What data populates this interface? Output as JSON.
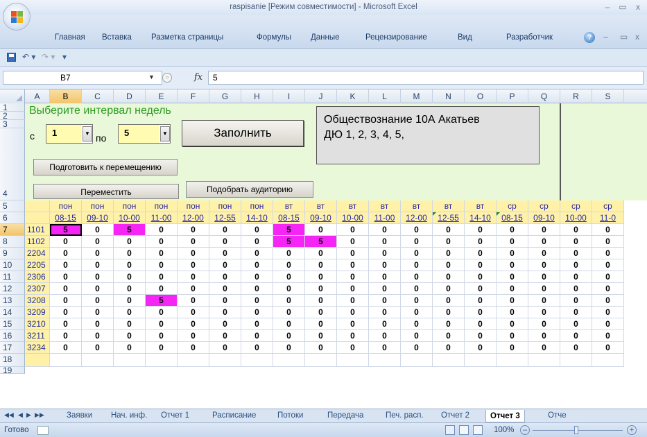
{
  "window": {
    "title": "raspisanie  [Режим совместимости]  -  Microsoft Excel",
    "minimize": "–",
    "restore": "▭",
    "close": "x"
  },
  "ribbon": {
    "tabs": [
      "Главная",
      "Вставка",
      "Разметка страницы",
      "Формулы",
      "Данные",
      "Рецензирование",
      "Вид",
      "Разработчик"
    ],
    "help": "?"
  },
  "formula_bar": {
    "name_box": "B7",
    "fx": "fx",
    "value": "5"
  },
  "columns": [
    "A",
    "B",
    "C",
    "D",
    "E",
    "F",
    "G",
    "H",
    "I",
    "J",
    "K",
    "L",
    "M",
    "N",
    "O",
    "P",
    "Q",
    "R",
    "S"
  ],
  "row_numbers": [
    "1",
    "2",
    "3",
    "4",
    "5",
    "6",
    "7",
    "8",
    "9",
    "10",
    "11",
    "12",
    "13",
    "14",
    "15",
    "16",
    "17",
    "18",
    "19"
  ],
  "controls": {
    "interval_label": "Выберите интервал недель",
    "from_label": "с",
    "from_value": "1",
    "to_label": "по",
    "to_value": "5",
    "fill_button": "Заполнить",
    "info_line1": "Обществознание 10А Акатьев",
    "info_line2": "ДЮ  1, 2, 3, 4, 5,",
    "prepare_button": "Подготовить к перемещению",
    "move_button": "Переместить",
    "pick_room_button": "Подобрать аудиторию"
  },
  "grid": {
    "days": [
      "пон",
      "пон",
      "пон",
      "пон",
      "пон",
      "пон",
      "пон",
      "вт",
      "вт",
      "вт",
      "вт",
      "вт",
      "вт",
      "вт",
      "ср",
      "ср",
      "ср",
      "ср"
    ],
    "times": [
      "08-15",
      "09-10",
      "10-00",
      "11-00",
      "12-00",
      "12-55",
      "14-10",
      "08-15",
      "09-10",
      "10-00",
      "11-00",
      "12-00",
      "12-55",
      "14-10",
      "08-15",
      "09-10",
      "10-00",
      "11-0"
    ],
    "rows": [
      {
        "room": "1101",
        "values": [
          "5",
          "0",
          "5",
          "0",
          "0",
          "0",
          "0",
          "5",
          "0",
          "0",
          "0",
          "0",
          "0",
          "0",
          "0",
          "0",
          "0",
          "0"
        ]
      },
      {
        "room": "1102",
        "values": [
          "0",
          "0",
          "0",
          "0",
          "0",
          "0",
          "0",
          "5",
          "5",
          "0",
          "0",
          "0",
          "0",
          "0",
          "0",
          "0",
          "0",
          "0"
        ]
      },
      {
        "room": "2204",
        "values": [
          "0",
          "0",
          "0",
          "0",
          "0",
          "0",
          "0",
          "0",
          "0",
          "0",
          "0",
          "0",
          "0",
          "0",
          "0",
          "0",
          "0",
          "0"
        ]
      },
      {
        "room": "2205",
        "values": [
          "0",
          "0",
          "0",
          "0",
          "0",
          "0",
          "0",
          "0",
          "0",
          "0",
          "0",
          "0",
          "0",
          "0",
          "0",
          "0",
          "0",
          "0"
        ]
      },
      {
        "room": "2306",
        "values": [
          "0",
          "0",
          "0",
          "0",
          "0",
          "0",
          "0",
          "0",
          "0",
          "0",
          "0",
          "0",
          "0",
          "0",
          "0",
          "0",
          "0",
          "0"
        ]
      },
      {
        "room": "2307",
        "values": [
          "0",
          "0",
          "0",
          "0",
          "0",
          "0",
          "0",
          "0",
          "0",
          "0",
          "0",
          "0",
          "0",
          "0",
          "0",
          "0",
          "0",
          "0"
        ]
      },
      {
        "room": "3208",
        "values": [
          "0",
          "0",
          "0",
          "5",
          "0",
          "0",
          "0",
          "0",
          "0",
          "0",
          "0",
          "0",
          "0",
          "0",
          "0",
          "0",
          "0",
          "0"
        ]
      },
      {
        "room": "3209",
        "values": [
          "0",
          "0",
          "0",
          "0",
          "0",
          "0",
          "0",
          "0",
          "0",
          "0",
          "0",
          "0",
          "0",
          "0",
          "0",
          "0",
          "0",
          "0"
        ]
      },
      {
        "room": "3210",
        "values": [
          "0",
          "0",
          "0",
          "0",
          "0",
          "0",
          "0",
          "0",
          "0",
          "0",
          "0",
          "0",
          "0",
          "0",
          "0",
          "0",
          "0",
          "0"
        ]
      },
      {
        "room": "3211",
        "values": [
          "0",
          "0",
          "0",
          "0",
          "0",
          "0",
          "0",
          "0",
          "0",
          "0",
          "0",
          "0",
          "0",
          "0",
          "0",
          "0",
          "0",
          "0"
        ]
      },
      {
        "room": "3234",
        "values": [
          "0",
          "0",
          "0",
          "0",
          "0",
          "0",
          "0",
          "0",
          "0",
          "0",
          "0",
          "0",
          "0",
          "0",
          "0",
          "0",
          "0",
          "0"
        ]
      }
    ],
    "highlight_color": "#f526f5"
  },
  "sheet_tabs": [
    "Заявки",
    "Нач. инф.",
    "Отчет 1",
    "Расписание",
    "Потоки",
    "Передача",
    "Печ. расп.",
    "Отчет 2",
    "Отчет 3",
    "Отче"
  ],
  "active_sheet": "Отчет 3",
  "status": {
    "ready": "Готово",
    "zoom": "100%"
  }
}
